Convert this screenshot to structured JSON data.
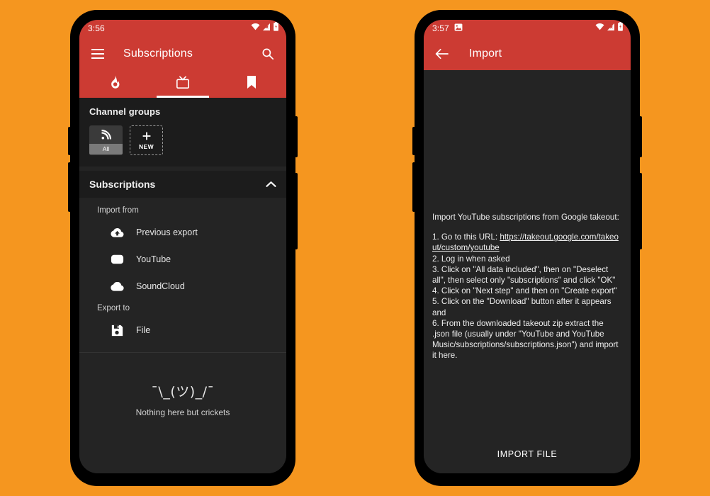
{
  "theme": {
    "accent_red": "#cc3b33",
    "background_orange": "#f5961f",
    "surface_dark": "#242424",
    "surface_darker": "#1c1c1c",
    "chip_fill": "#3a3a3a",
    "chip_label_fill": "#7a7a7a"
  },
  "left_phone": {
    "status_bar": {
      "time": "3:56",
      "icons": [
        "wifi-icon",
        "mobile-signal-icon",
        "battery-icon"
      ]
    },
    "toolbar": {
      "menu_icon": "hamburger-menu-icon",
      "title": "Subscriptions",
      "search_icon": "search-icon"
    },
    "tabs": [
      {
        "name": "trending",
        "icon": "flame-icon",
        "active": false
      },
      {
        "name": "subscriptions",
        "icon": "tv-icon",
        "active": true
      },
      {
        "name": "bookmarks",
        "icon": "bookmark-icon",
        "active": false
      }
    ],
    "channel_groups": {
      "heading": "Channel groups",
      "chips": [
        {
          "label": "All",
          "icon": "rss-icon",
          "style": "filled"
        },
        {
          "label": "NEW",
          "icon": "plus-icon",
          "style": "dashed"
        }
      ]
    },
    "subscriptions_section": {
      "heading": "Subscriptions",
      "collapse_icon": "chevron-up-icon",
      "import_caption": "Import from",
      "import_items": [
        {
          "label": "Previous export",
          "icon": "cloud-upload-icon"
        },
        {
          "label": "YouTube",
          "icon": "youtube-icon"
        },
        {
          "label": "SoundCloud",
          "icon": "cloud-icon"
        }
      ],
      "export_caption": "Export to",
      "export_items": [
        {
          "label": "File",
          "icon": "save-floppy-icon"
        }
      ]
    },
    "empty_state": {
      "shrug": "¯\\_(ツ)_/¯",
      "message": "Nothing here but crickets"
    }
  },
  "right_phone": {
    "status_bar": {
      "time": "3:57",
      "left_icons": [
        "image-screenshot-icon"
      ],
      "icons": [
        "wifi-icon",
        "mobile-signal-icon",
        "battery-icon"
      ]
    },
    "toolbar": {
      "back_icon": "back-arrow-icon",
      "title": "Import"
    },
    "import_screen": {
      "intro": "Import YouTube subscriptions from Google takeout:",
      "step1_prefix": "1. Go to this URL: ",
      "step1_url": "https://takeout.google.com/takeout/custom/youtube",
      "step2": "2. Log in when asked",
      "step3": "3. Click on \"All data included\", then on \"Deselect all\", then select only \"subscriptions\" and click \"OK\"",
      "step4": "4. Click on \"Next step\" and then on \"Create export\"",
      "step5": "5. Click on the \"Download\" button after it appears and",
      "step6": "6. From the downloaded takeout zip extract the .json file (usually under \"YouTube and YouTube Music/subscriptions/subscriptions.json\") and import it here.",
      "action_button": "IMPORT FILE"
    }
  }
}
